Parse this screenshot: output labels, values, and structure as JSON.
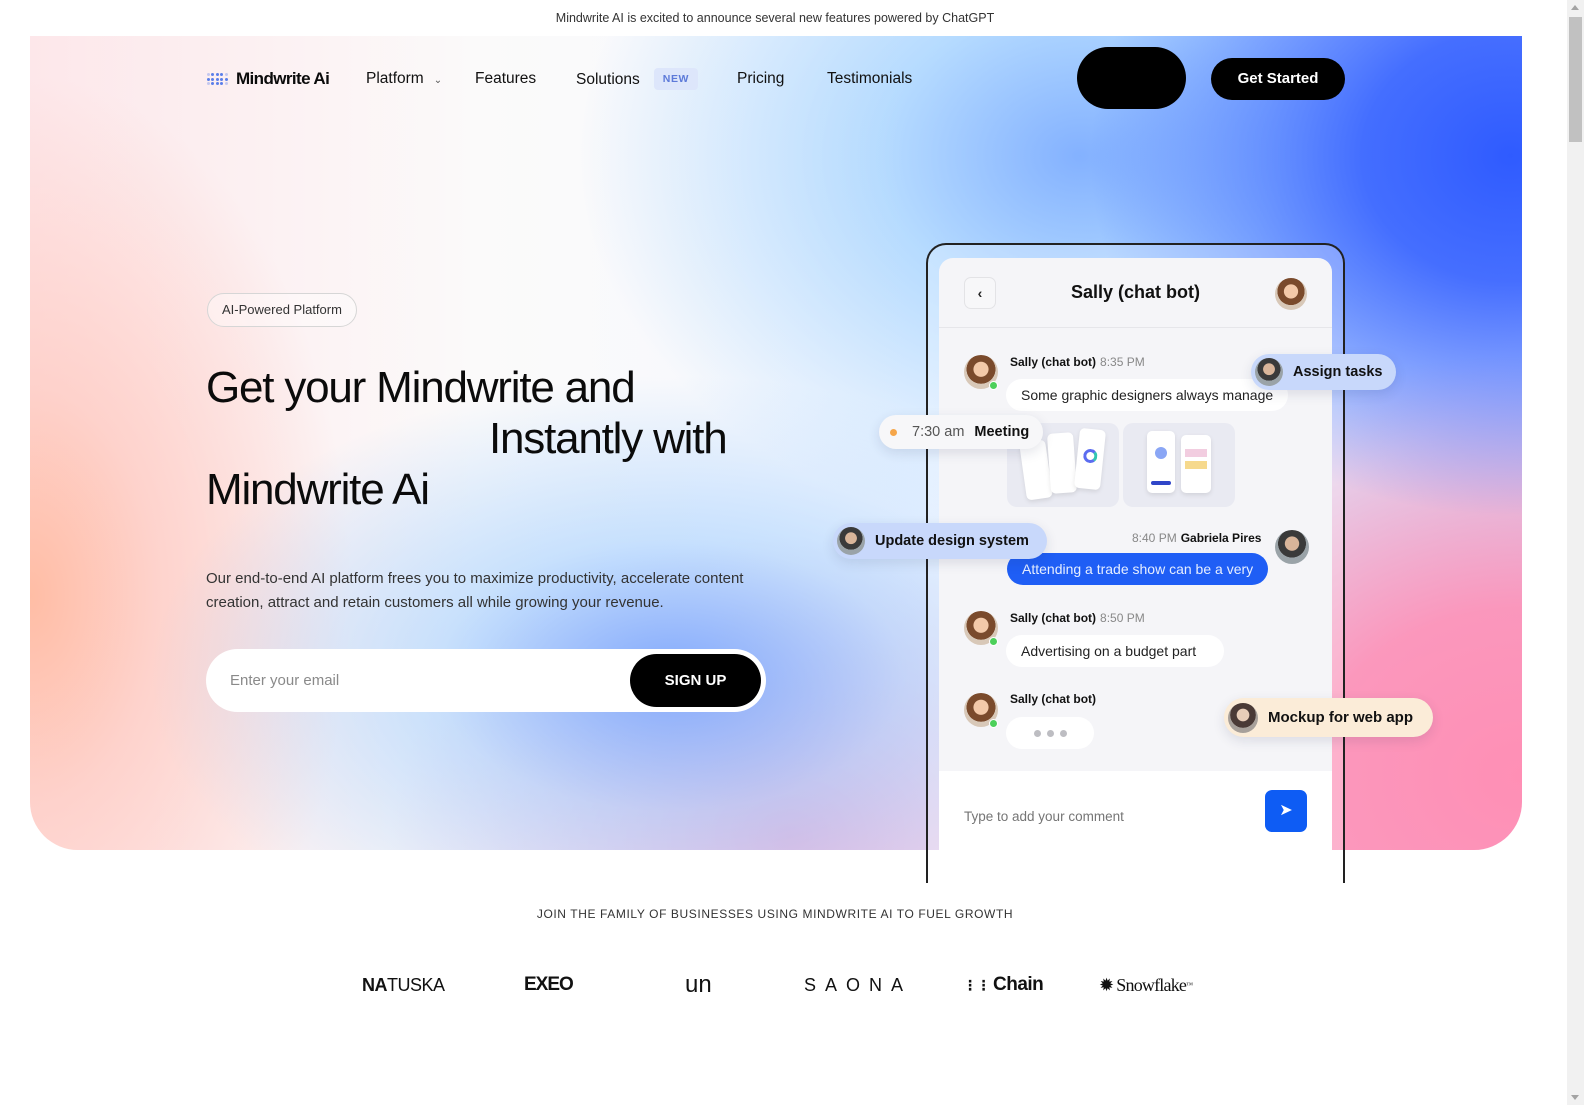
{
  "announcement": "Mindwrite AI is excited to announce several new features powered by ChatGPT",
  "nav": {
    "logo_text": "Mindwrite Ai",
    "items": [
      {
        "label": "Platform",
        "has_dropdown": true
      },
      {
        "label": "Features"
      },
      {
        "label": "Solutions",
        "badge": "NEW"
      },
      {
        "label": "Pricing"
      },
      {
        "label": "Testimonials"
      }
    ],
    "cta_label": "Get Started"
  },
  "hero": {
    "tag": "AI-Powered Platform",
    "headline_line1": "Get your Mindwrite and",
    "headline_line2": "Instantly with",
    "headline_line3": "Mindwrite Ai",
    "subtext": "Our end-to-end AI platform frees you to maximize productivity, accelerate content creation, attract and retain customers all while growing your revenue.",
    "email_placeholder": "Enter your email",
    "signup_label": "SIGN UP"
  },
  "chat": {
    "title": "Sally (chat bot)",
    "back_icon": "‹",
    "messages": [
      {
        "sender": "Sally (chat bot)",
        "time": "8:35 PM",
        "text": "Some graphic designers always manage"
      },
      {
        "sender": "Gabriela Pires",
        "time": "8:40 PM",
        "text": "Attending a trade show can be a very"
      },
      {
        "sender": "Sally (chat bot)",
        "time": "8:50 PM",
        "text": "Advertising on a budget part"
      },
      {
        "sender": "Sally (chat bot)",
        "time": "",
        "text": "typing"
      }
    ],
    "compose_placeholder": "Type to add your comment",
    "send_icon": "➤"
  },
  "floating_cards": {
    "assign": "Assign tasks",
    "meeting_time": "7:30 am",
    "meeting_label": "Meeting",
    "update": "Update design system",
    "mockup": "Mockup for web app"
  },
  "colors": {
    "accent_blue": "#1f5ef5",
    "send_blue": "#0e5cf4",
    "meeting_dot": "#f5a64a",
    "online_green": "#4cd05a"
  },
  "clients": {
    "title": "JOIN THE FAMILY OF BUSINESSES USING MINDWRITE AI TO FUEL GROWTH",
    "logos": [
      {
        "bold": "NA",
        "rest": "TUSKA"
      },
      {
        "bold": "EXEO"
      },
      {
        "bold": "un"
      },
      {
        "bold": "SAONA"
      },
      {
        "bold": "Chain"
      },
      {
        "bold": "Snowflake"
      }
    ]
  }
}
